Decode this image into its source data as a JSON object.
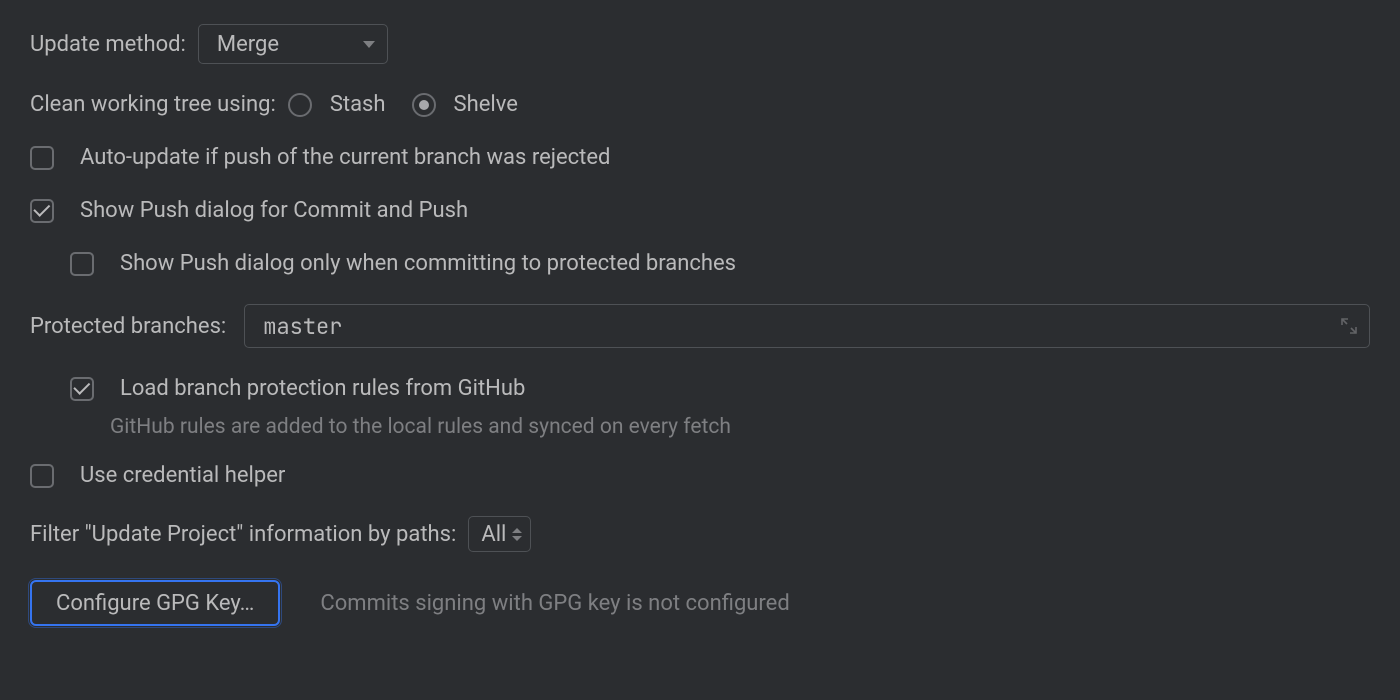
{
  "update_method": {
    "label": "Update method:",
    "value": "Merge"
  },
  "clean_tree": {
    "label": "Clean working tree using:",
    "options": {
      "stash": "Stash",
      "shelve": "Shelve"
    },
    "selected": "shelve"
  },
  "auto_update": {
    "label": "Auto-update if push of the current branch was rejected",
    "checked": false
  },
  "show_push": {
    "label": "Show Push dialog for Commit and Push",
    "checked": true
  },
  "show_push_protected": {
    "label": "Show Push dialog only when committing to protected branches",
    "checked": false
  },
  "protected": {
    "label": "Protected branches:",
    "value": "master"
  },
  "load_github_rules": {
    "label": "Load branch protection rules from GitHub",
    "checked": true,
    "help": "GitHub rules are added to the local rules and synced on every fetch"
  },
  "credential_helper": {
    "label": "Use credential helper",
    "checked": false
  },
  "filter_paths": {
    "label": "Filter \"Update Project\" information by paths:",
    "value": "All"
  },
  "gpg": {
    "button": "Configure GPG Key…",
    "hint": "Commits signing with GPG key is not configured"
  }
}
